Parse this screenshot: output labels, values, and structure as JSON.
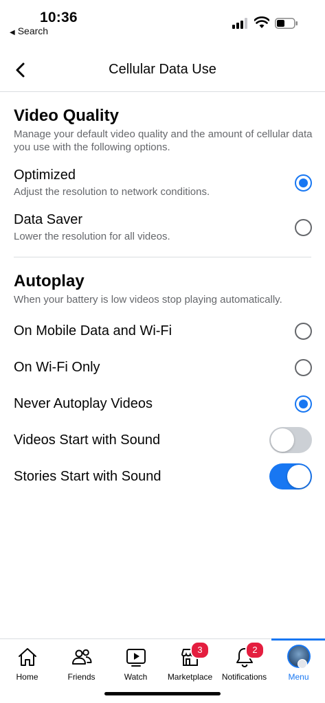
{
  "status_bar": {
    "time": "10:36",
    "back_app": "Search"
  },
  "header": {
    "title": "Cellular Data Use"
  },
  "video_quality": {
    "title": "Video Quality",
    "description": "Manage your default video quality and the amount of cellular data you use with the following options.",
    "options": [
      {
        "label": "Optimized",
        "sublabel": "Adjust the resolution to network conditions.",
        "selected": true
      },
      {
        "label": "Data Saver",
        "sublabel": "Lower the resolution for all videos.",
        "selected": false
      }
    ]
  },
  "autoplay": {
    "title": "Autoplay",
    "description": "When your battery is low videos stop playing automatically.",
    "options": [
      {
        "label": "On Mobile Data and Wi-Fi",
        "selected": false
      },
      {
        "label": "On Wi-Fi Only",
        "selected": false
      },
      {
        "label": "Never Autoplay Videos",
        "selected": true
      }
    ],
    "toggles": [
      {
        "label": "Videos Start with Sound",
        "on": false
      },
      {
        "label": "Stories Start with Sound",
        "on": true
      }
    ]
  },
  "tab_bar": {
    "tabs": [
      {
        "label": "Home",
        "icon": "home-icon"
      },
      {
        "label": "Friends",
        "icon": "friends-icon"
      },
      {
        "label": "Watch",
        "icon": "watch-icon"
      },
      {
        "label": "Marketplace",
        "icon": "marketplace-icon",
        "badge": "3"
      },
      {
        "label": "Notifications",
        "icon": "bell-icon",
        "badge": "2"
      },
      {
        "label": "Menu",
        "icon": "avatar",
        "active": true
      }
    ]
  },
  "colors": {
    "accent": "#1877f2",
    "badge": "#e41e3f",
    "secondary_text": "#65676b",
    "toggle_off": "#ccd0d5"
  }
}
